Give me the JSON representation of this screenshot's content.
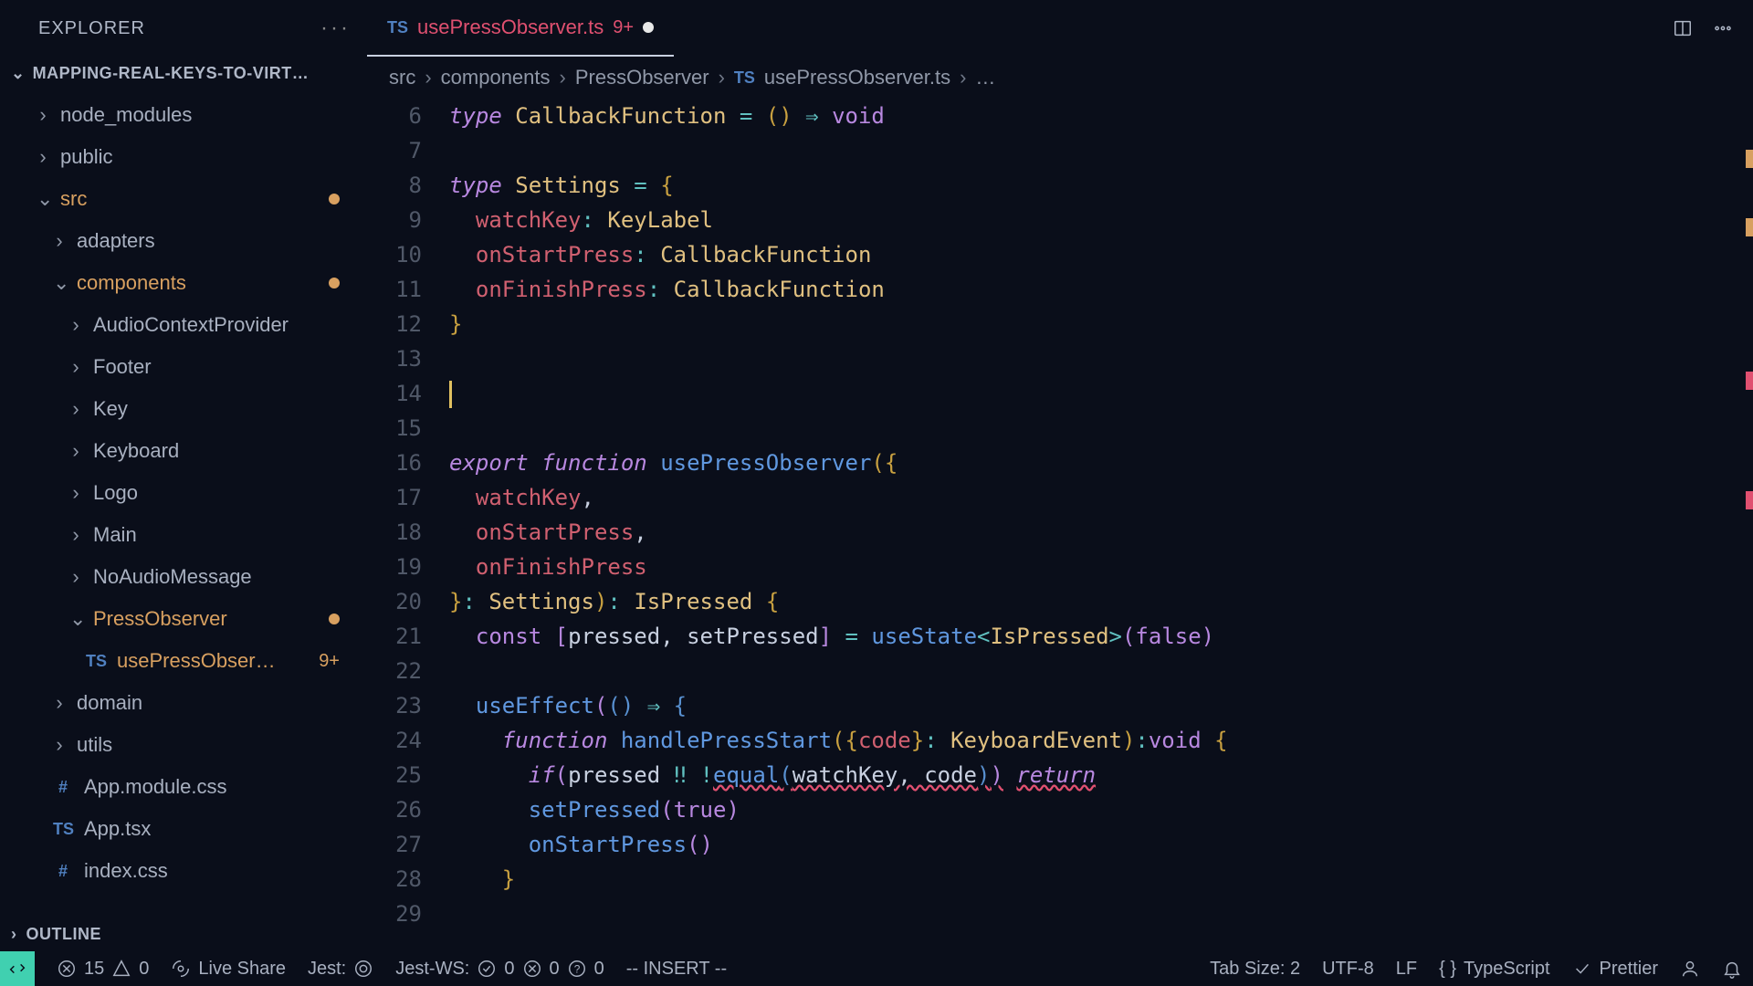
{
  "explorer": {
    "title": "EXPLORER"
  },
  "project": {
    "name": "MAPPING-REAL-KEYS-TO-VIRT…"
  },
  "tree": [
    {
      "label": "node_modules",
      "indent": 40,
      "chev": "›",
      "mod": false
    },
    {
      "label": "public",
      "indent": 40,
      "chev": "›",
      "mod": false
    },
    {
      "label": "src",
      "indent": 40,
      "chev": "⌄",
      "mod": true,
      "dot": true
    },
    {
      "label": "adapters",
      "indent": 58,
      "chev": "›",
      "mod": false
    },
    {
      "label": "components",
      "indent": 58,
      "chev": "⌄",
      "mod": true,
      "dot": true
    },
    {
      "label": "AudioContextProvider",
      "indent": 76,
      "chev": "›",
      "mod": false
    },
    {
      "label": "Footer",
      "indent": 76,
      "chev": "›",
      "mod": false
    },
    {
      "label": "Key",
      "indent": 76,
      "chev": "›",
      "mod": false
    },
    {
      "label": "Keyboard",
      "indent": 76,
      "chev": "›",
      "mod": false
    },
    {
      "label": "Logo",
      "indent": 76,
      "chev": "›",
      "mod": false
    },
    {
      "label": "Main",
      "indent": 76,
      "chev": "›",
      "mod": false
    },
    {
      "label": "NoAudioMessage",
      "indent": 76,
      "chev": "›",
      "mod": false
    },
    {
      "label": "PressObserver",
      "indent": 76,
      "chev": "⌄",
      "mod": true,
      "dot": true
    },
    {
      "label": "usePressObser…",
      "indent": 94,
      "ficon": "TS",
      "mod": true,
      "badge": "9+"
    },
    {
      "label": "domain",
      "indent": 58,
      "chev": "›",
      "mod": false
    },
    {
      "label": "utils",
      "indent": 58,
      "chev": "›",
      "mod": false
    },
    {
      "label": "App.module.css",
      "indent": 58,
      "ficon": "#",
      "mod": false
    },
    {
      "label": "App.tsx",
      "indent": 58,
      "ficon": "TS",
      "mod": false
    },
    {
      "label": "index.css",
      "indent": 58,
      "ficon": "#",
      "mod": false
    }
  ],
  "outline": {
    "label": "OUTLINE"
  },
  "tab": {
    "file": "usePressObserver.ts",
    "count": "9+"
  },
  "breadcrumb": {
    "parts": [
      "src",
      "components",
      "PressObserver",
      "usePressObserver.ts"
    ],
    "tail": "…"
  },
  "gutter": [
    "",
    "6",
    "7",
    "8",
    "9",
    "10",
    "11",
    "12",
    "13",
    "14",
    "15",
    "16",
    "17",
    "18",
    "19",
    "20",
    "21",
    "22",
    "23",
    "24",
    "25",
    "26",
    "27",
    "28",
    "29"
  ],
  "status": {
    "errors": "15",
    "warnings": "0",
    "liveshare": "Live Share",
    "jest": "Jest:",
    "jestws": "Jest-WS:",
    "jestws_pass": "0",
    "jestws_fail": "0",
    "jestws_unk": "0",
    "mode": "-- INSERT --",
    "tabsize": "Tab Size: 2",
    "encoding": "UTF-8",
    "eol": "LF",
    "lang": "TypeScript",
    "prettier": "Prettier"
  }
}
